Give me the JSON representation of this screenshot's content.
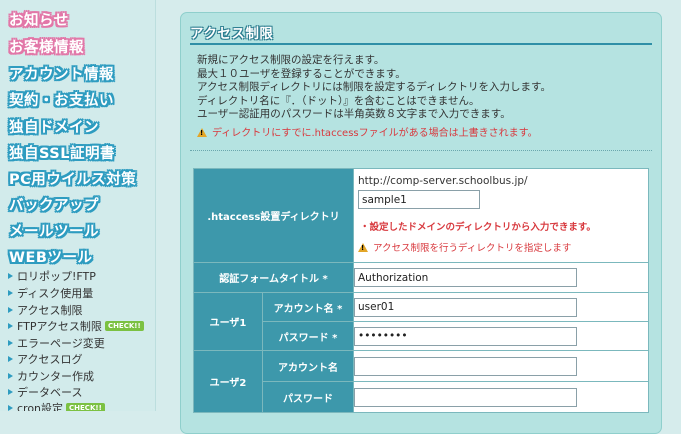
{
  "sidebar": {
    "main_items": [
      {
        "label": "お知らせ",
        "style": "pink"
      },
      {
        "label": "お客様情報",
        "style": "pink"
      },
      {
        "label": "アカウント情報",
        "style": "blue"
      },
      {
        "label": "契約・お支払い",
        "style": "blue"
      },
      {
        "label": "独自ドメイン",
        "style": "blue"
      },
      {
        "label": "独自SSL証明書",
        "style": "blue"
      },
      {
        "label": "PC用ウイルス対策",
        "style": "blue"
      },
      {
        "label": "バックアップ",
        "style": "blue"
      },
      {
        "label": "メールツール",
        "style": "blue"
      },
      {
        "label": "WEBツール",
        "style": "blue"
      }
    ],
    "sub_items": [
      {
        "label": "ロリポップ!FTP"
      },
      {
        "label": "ディスク使用量"
      },
      {
        "label": "アクセス制限"
      },
      {
        "label": "FTPアクセス制限",
        "badge": "CHECK!!"
      },
      {
        "label": "エラーページ変更"
      },
      {
        "label": "アクセスログ"
      },
      {
        "label": "カウンター作成"
      },
      {
        "label": "データベース"
      },
      {
        "label": "cron設定",
        "badge": "CHECK!!"
      }
    ]
  },
  "page": {
    "title": "アクセス制限",
    "intro": [
      "新規にアクセス制限の設定を行えます。",
      "最大１０ユーザを登録することができます。",
      "アクセス制限ディレクトリには制限を設定するディレクトリを入力します。",
      "ディレクトリ名に『．（ドット）』を含むことはできません。",
      "ユーザー認証用のパスワードは半角英数８文字まで入力できます。"
    ],
    "warning": "ディレクトリにすでに.htaccessファイルがある場合は上書きされます。"
  },
  "form": {
    "htaccess_label": ".htaccess設置ディレクトリ",
    "base_url": "http://comp-server.schoolbus.jp/",
    "directory_value": "sample1",
    "directory_note": "・設定したドメインのディレクトリから入力できます。",
    "directory_warning": "アクセス制限を行うディレクトリを指定します",
    "auth_title_label": "認証フォームタイトル *",
    "auth_title_value": "Authorization",
    "user1_label": "ユーザ1",
    "user2_label": "ユーザ2",
    "account_required_label": "アカウント名 *",
    "password_required_label": "パスワード *",
    "account_label": "アカウント名",
    "password_label": "パスワード",
    "user1_account": "user01",
    "user1_password": "••••••••",
    "user2_account": "",
    "user2_password": ""
  },
  "colors": {
    "header_cell": "#3d98ab",
    "panel": "#b5e3e1",
    "warning_text": "#d8393e",
    "badge": "#7bc142"
  }
}
